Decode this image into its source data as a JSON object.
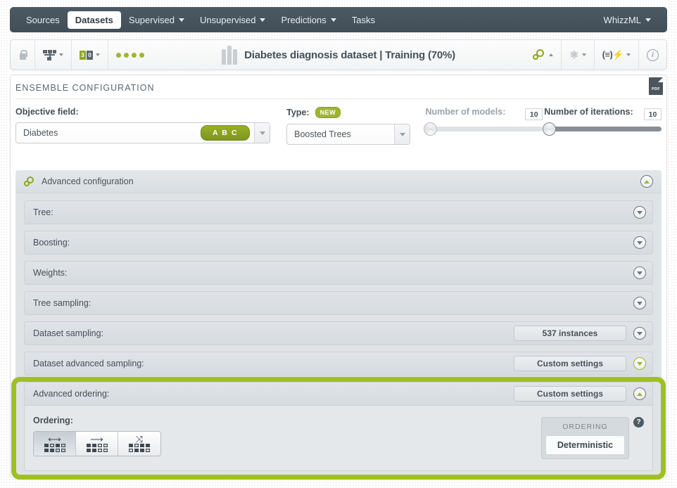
{
  "nav": {
    "items": [
      {
        "label": "Sources",
        "active": false,
        "caret": false
      },
      {
        "label": "Datasets",
        "active": true,
        "caret": false
      },
      {
        "label": "Supervised",
        "active": false,
        "caret": true
      },
      {
        "label": "Unsupervised",
        "active": false,
        "caret": true
      },
      {
        "label": "Predictions",
        "active": false,
        "caret": true
      },
      {
        "label": "Tasks",
        "active": false,
        "caret": false
      }
    ],
    "right": {
      "label": "WhizzML",
      "caret": true
    }
  },
  "resource_bar": {
    "title": "Diabetes diagnosis dataset | Training (70%)",
    "lock_icon": "lock-icon",
    "network_icon": "dataset-split-icon",
    "counts_icon": "field-counts-icon",
    "dots_icon": "status-dots-icon",
    "dataset_icon": "dataset-bars-icon",
    "config_icon": "gears-icon",
    "lightning_icon": "one-click-icon",
    "script_icon": "script-icon",
    "info_icon": "info-icon"
  },
  "panel": {
    "title": "ENSEMBLE CONFIGURATION",
    "pdf_label": "PDF"
  },
  "config": {
    "objective": {
      "label": "Objective field:",
      "value": "Diabetes",
      "type_badge": "A B C"
    },
    "type": {
      "label": "Type:",
      "badge": "NEW",
      "value": "Boosted Trees"
    },
    "models": {
      "label": "Number of models:",
      "value": "10",
      "enabled": false
    },
    "iterations": {
      "label": "Number of iterations:",
      "value": "10",
      "enabled": true
    }
  },
  "advanced": {
    "header": "Advanced configuration",
    "sections": [
      {
        "name": "Tree:",
        "button": null,
        "state": "collapsed",
        "chevron_color": "gray"
      },
      {
        "name": "Boosting:",
        "button": null,
        "state": "collapsed",
        "chevron_color": "gray"
      },
      {
        "name": "Weights:",
        "button": null,
        "state": "collapsed",
        "chevron_color": "gray"
      },
      {
        "name": "Tree sampling:",
        "button": null,
        "state": "collapsed",
        "chevron_color": "gray"
      },
      {
        "name": "Dataset sampling:",
        "button": "537 instances",
        "state": "collapsed",
        "chevron_color": "gray"
      },
      {
        "name": "Dataset advanced sampling:",
        "button": "Custom settings",
        "state": "collapsed",
        "chevron_color": "green"
      }
    ],
    "ordering_section": {
      "name": "Advanced ordering:",
      "button": "Custom settings",
      "state": "expanded",
      "highlighted": true,
      "ordering_label": "Ordering:",
      "buttons": [
        {
          "icon": "bidirectional-arrow-icon",
          "selected": true
        },
        {
          "icon": "right-arrow-icon",
          "selected": false
        },
        {
          "icon": "shuffle-arrows-icon",
          "selected": false
        }
      ],
      "card": {
        "caption": "ORDERING",
        "value": "Deterministic"
      },
      "help_icon": "help-icon"
    }
  },
  "colors": {
    "accent_green": "#9fb62b",
    "highlight_green": "#9ec020",
    "nav_dark": "#44515a",
    "panel_gray": "#dfe3e6"
  }
}
